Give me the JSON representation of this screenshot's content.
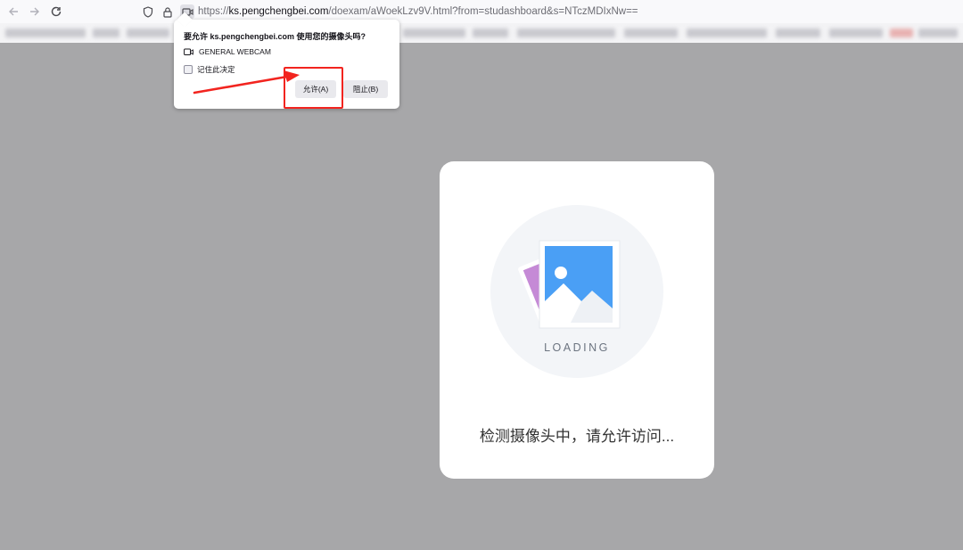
{
  "browser": {
    "url_prefix": "https://",
    "url_domain": "ks.pengchengbei.com",
    "url_path": "/doexam/aWoekLzv9V.html?from=studashboard&s=NTczMDIxNw==",
    "icons": [
      "back-icon",
      "forward-icon",
      "reload-icon",
      "shield-icon",
      "lock-icon",
      "camera-permission-icon"
    ]
  },
  "permission_popup": {
    "title": "要允许 ks.pengchengbei.com 使用您的摄像头吗?",
    "device": "GENERAL WEBCAM",
    "remember_label": "记住此决定",
    "allow_label": "允许(A)",
    "block_label": "阻止(B)"
  },
  "loading_card": {
    "loading_word": "LOADING",
    "status_text": "检测摄像头中，请允许访问..."
  },
  "colors": {
    "page_background": "#a7a7a9",
    "annotation_red": "#f2241f",
    "image_blue": "#4a9ff5",
    "image_purple": "#c58ad6"
  }
}
